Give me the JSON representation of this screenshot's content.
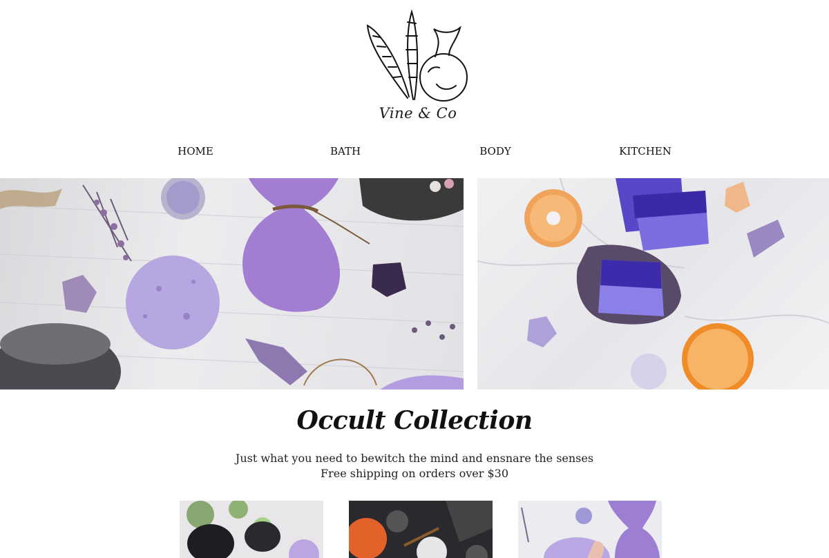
{
  "brand": {
    "name": "Vine & Co"
  },
  "nav": {
    "items": [
      {
        "label": "HOME"
      },
      {
        "label": "BATH"
      },
      {
        "label": "BODY"
      },
      {
        "label": "KITCHEN"
      }
    ]
  },
  "collection": {
    "title": "Occult Collection",
    "tagline": "Just what you need to bewitch the mind and ensnare the senses",
    "shipping": "Free shipping on orders over $30"
  },
  "colors": {
    "lavender": "#a98ad6",
    "purple_dark": "#4a2e8c",
    "orange": "#e98a2a"
  }
}
